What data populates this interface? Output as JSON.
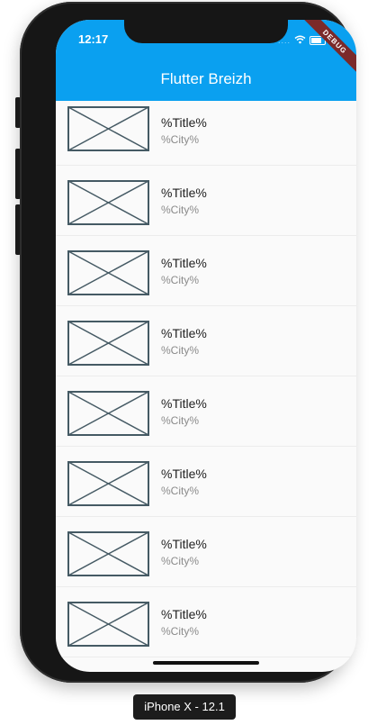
{
  "status_bar": {
    "time": "12:17",
    "signal": "....",
    "debug_banner": "DEBUG"
  },
  "app_bar": {
    "title": "Flutter Breizh",
    "background": "#0aa0f0"
  },
  "list": {
    "items": [
      {
        "title": "%Title%",
        "city": "%City%"
      },
      {
        "title": "%Title%",
        "city": "%City%"
      },
      {
        "title": "%Title%",
        "city": "%City%"
      },
      {
        "title": "%Title%",
        "city": "%City%"
      },
      {
        "title": "%Title%",
        "city": "%City%"
      },
      {
        "title": "%Title%",
        "city": "%City%"
      },
      {
        "title": "%Title%",
        "city": "%City%"
      },
      {
        "title": "%Title%",
        "city": "%City%"
      }
    ]
  },
  "device": {
    "label": "iPhone X - 12.1"
  }
}
